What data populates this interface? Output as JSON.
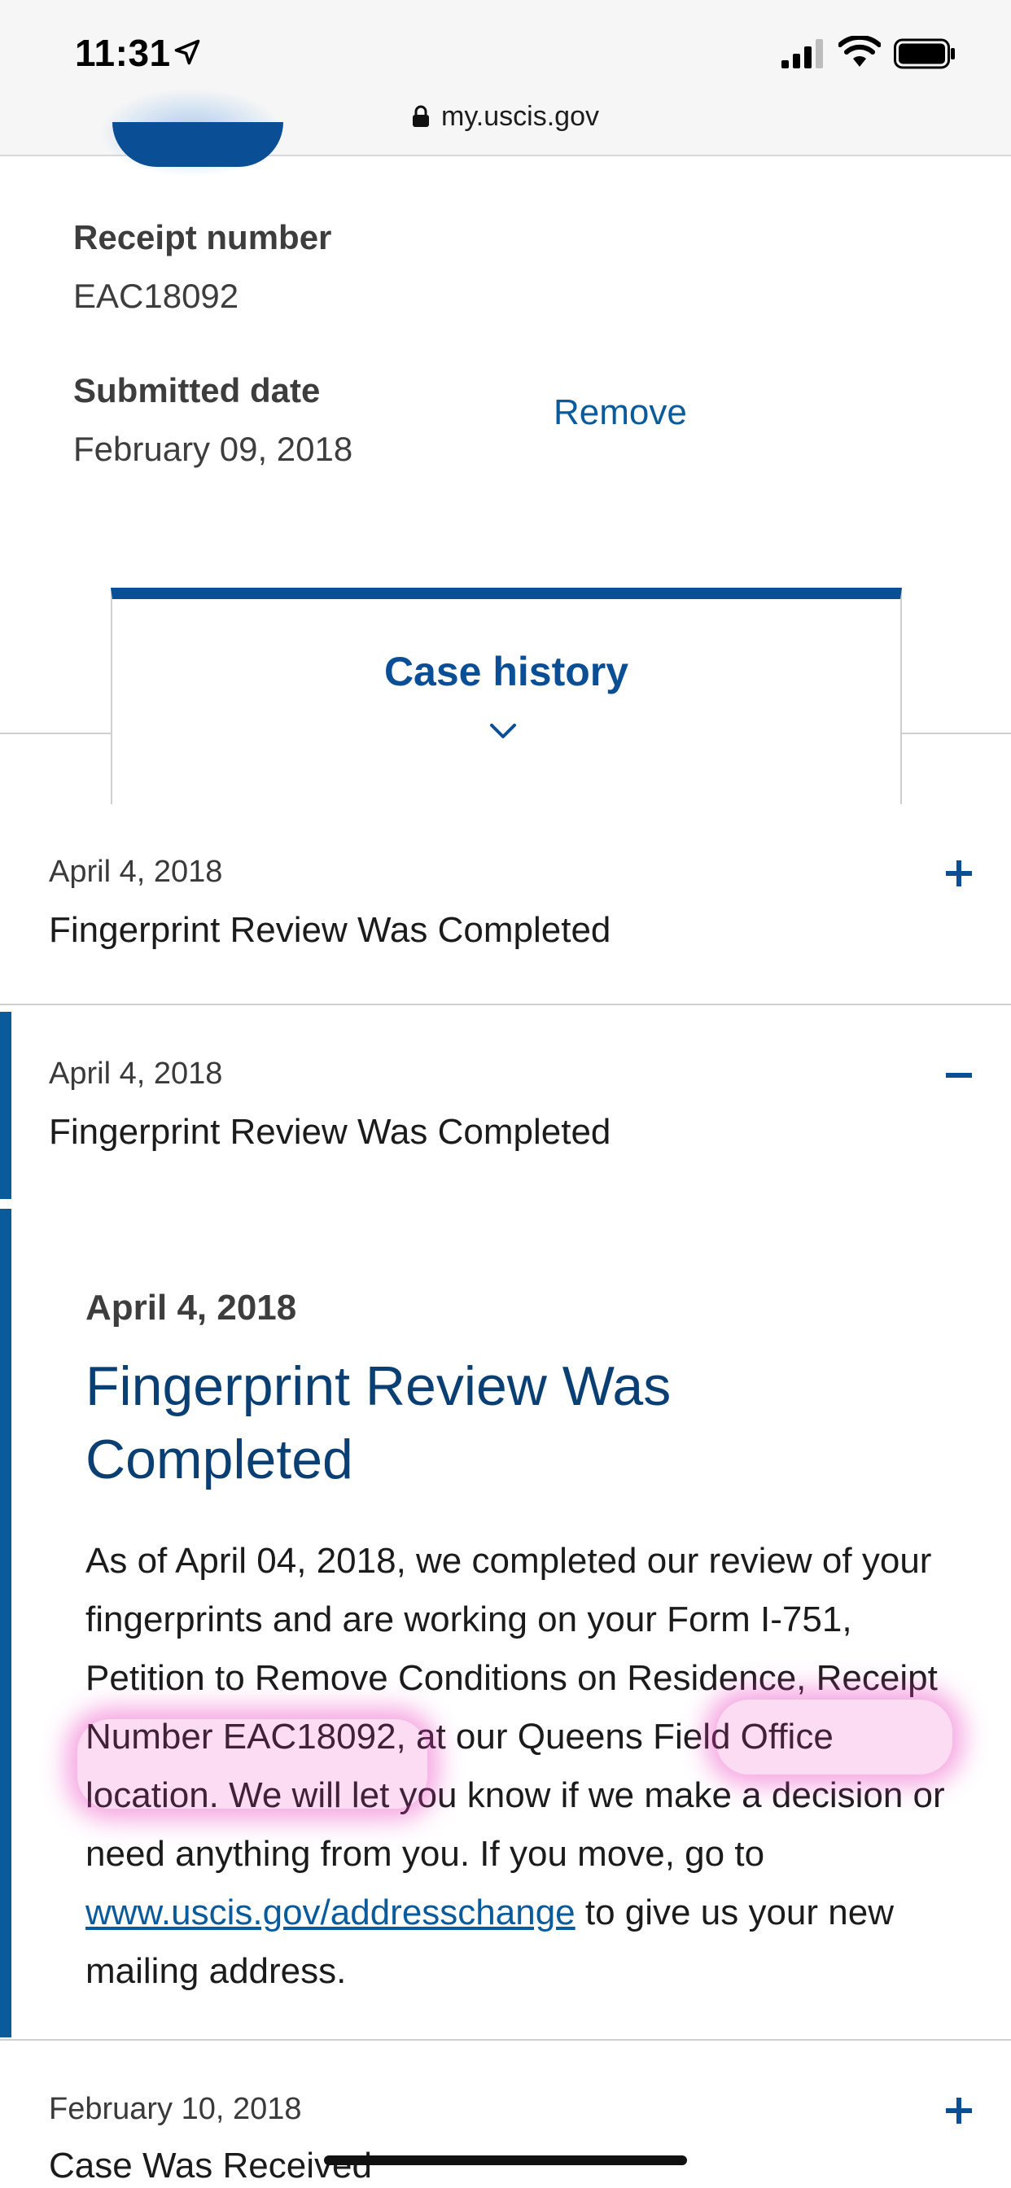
{
  "status_bar": {
    "time": "11:31"
  },
  "browser": {
    "url": "my.uscis.gov"
  },
  "case": {
    "receipt_label": "Receipt number",
    "receipt_value": "EAC18092",
    "submitted_label": "Submitted date",
    "submitted_value": "February 09, 2018",
    "remove_label": "Remove"
  },
  "case_history_tab": {
    "label": "Case history"
  },
  "history": [
    {
      "date": "April 4, 2018",
      "title": "Fingerprint Review Was Completed",
      "toggle": "+"
    },
    {
      "date": "April 4, 2018",
      "title": "Fingerprint Review Was Completed",
      "toggle": "−"
    }
  ],
  "detail": {
    "date": "April 4, 2018",
    "title": "Fingerprint Review Was Completed",
    "body_part1": "As of April 04, 2018, we completed our review of your fingerprints and are working on your Form I-751, Petition to Remove Conditions on Residence, Receipt Number EAC18092",
    "body_part2": ", at our Queens Field Office location. We will let you know if we make a decision or need anything from you. If you move, go to ",
    "link": "www.uscis.gov/addresschange",
    "body_part3": " to give us your new mailing address."
  },
  "next_item": {
    "date": "February 10, 2018",
    "title": "Case Was Received",
    "toggle": "+"
  },
  "colors": {
    "primary": "#0a4f96",
    "link": "#0a5b9c",
    "title_dark": "#0a3f74",
    "highlight": "#eb3cbe"
  }
}
